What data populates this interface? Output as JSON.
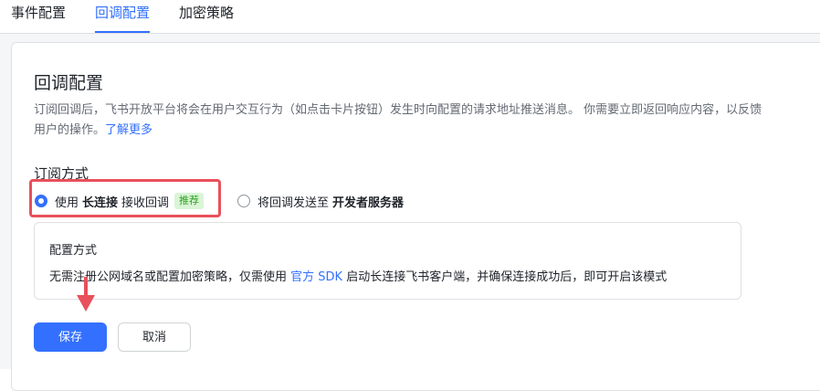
{
  "tabs": [
    {
      "label": "事件配置",
      "active": false
    },
    {
      "label": "回调配置",
      "active": true
    },
    {
      "label": "加密策略",
      "active": false
    }
  ],
  "section": {
    "title": "回调配置",
    "description": "订阅回调后，飞书开放平台将会在用户交互行为（如点击卡片按钮）发生时向配置的请求地址推送消息。 你需要立即返回响应内容，以反馈用户的操作。",
    "learn_more": "了解更多"
  },
  "subscription": {
    "label": "订阅方式",
    "options": [
      {
        "prefix": "使用",
        "bold": "长连接",
        "suffix": "接收回调",
        "tag": "推荐",
        "checked": true
      },
      {
        "prefix": "将回调发送至",
        "bold": "开发者服务器",
        "suffix": "",
        "tag": "",
        "checked": false
      }
    ]
  },
  "config": {
    "title": "配置方式",
    "text_before": "无需注册公网域名或配置加密策略，仅需使用",
    "link": "官方 SDK",
    "text_after": "启动长连接飞书客户端，并确保连接成功后，即可开启该模式"
  },
  "buttons": {
    "save": "保存",
    "cancel": "取消"
  },
  "colors": {
    "accent": "#3370ff",
    "highlight": "#e8505b",
    "tag_bg": "#d9f5d6",
    "tag_text": "#2ea121"
  }
}
